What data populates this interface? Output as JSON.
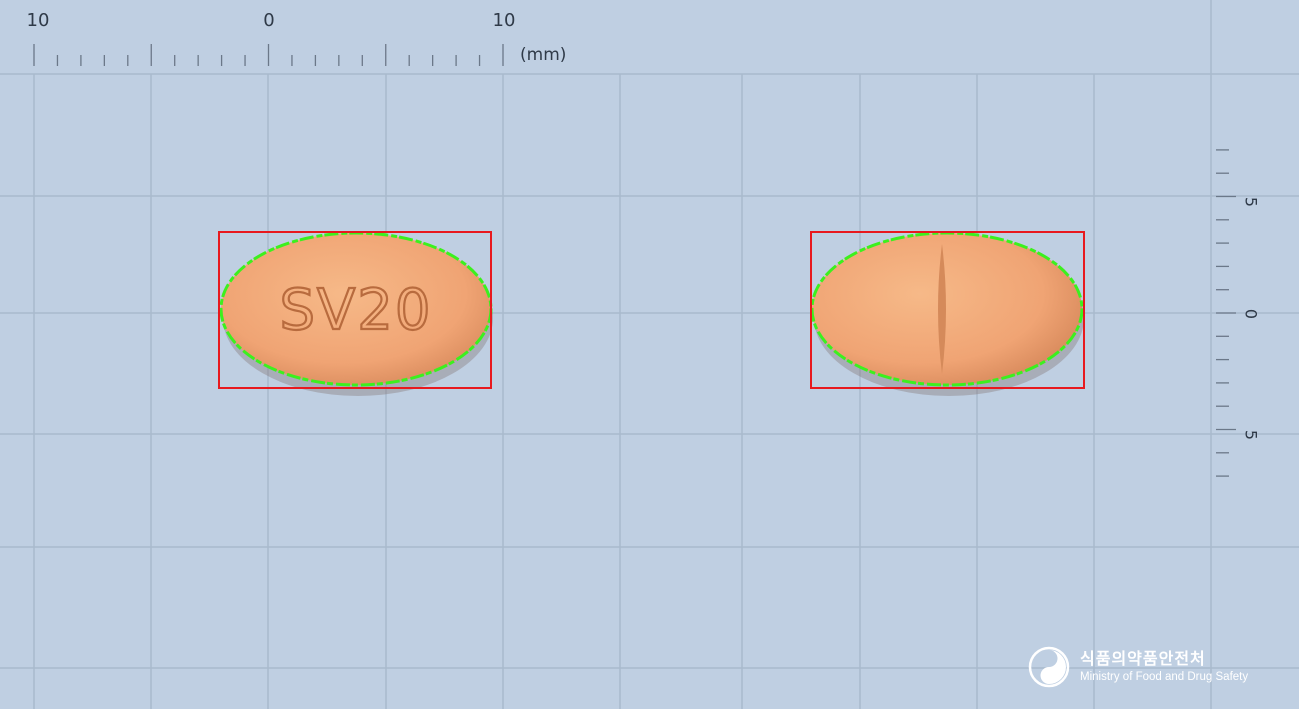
{
  "ruler": {
    "h_labels": [
      "10",
      "0",
      "10"
    ],
    "unit": "(mm)",
    "v_labels": [
      "5",
      "0",
      "5"
    ]
  },
  "pills": [
    {
      "side": "front",
      "imprint": "SV20",
      "color": "#f2a877"
    },
    {
      "side": "back",
      "imprint": "",
      "score_line": true,
      "color": "#f2a877"
    }
  ],
  "colors": {
    "background": "#bfcfe2",
    "grid": "#a9bacd",
    "bounding_box": "#e8191e",
    "contour": "#3cf01e",
    "imprint": "#b86b3e"
  },
  "logo": {
    "korean": "식품의약품안전처",
    "english": "Ministry of Food and Drug Safety",
    "icon": "mfds-logo-icon"
  }
}
